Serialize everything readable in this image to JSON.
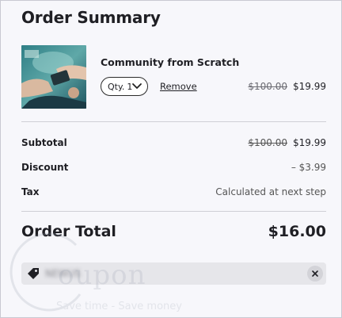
{
  "title": "Order Summary",
  "product": {
    "name": "Community from Scratch",
    "qty_label": "Qty.",
    "qty_value": "1",
    "remove_label": "Remove",
    "old_price": "$100.00",
    "new_price": "$19.99"
  },
  "summary": {
    "subtotal_label": "Subtotal",
    "subtotal_old": "$100.00",
    "subtotal_new": "$19.99",
    "discount_label": "Discount",
    "discount_value": "– $3.99",
    "tax_label": "Tax",
    "tax_value": "Calculated at next step"
  },
  "total": {
    "label": "Order Total",
    "value": "$16.00"
  },
  "coupon": {
    "code": "NEWUS"
  },
  "watermark": {
    "word": "oupon",
    "tagline": "Save time - Save money"
  },
  "colors": {
    "panel_bg": "#f7f7fb",
    "coupon_bg": "#e6e6ea",
    "text": "#1f1f24"
  }
}
